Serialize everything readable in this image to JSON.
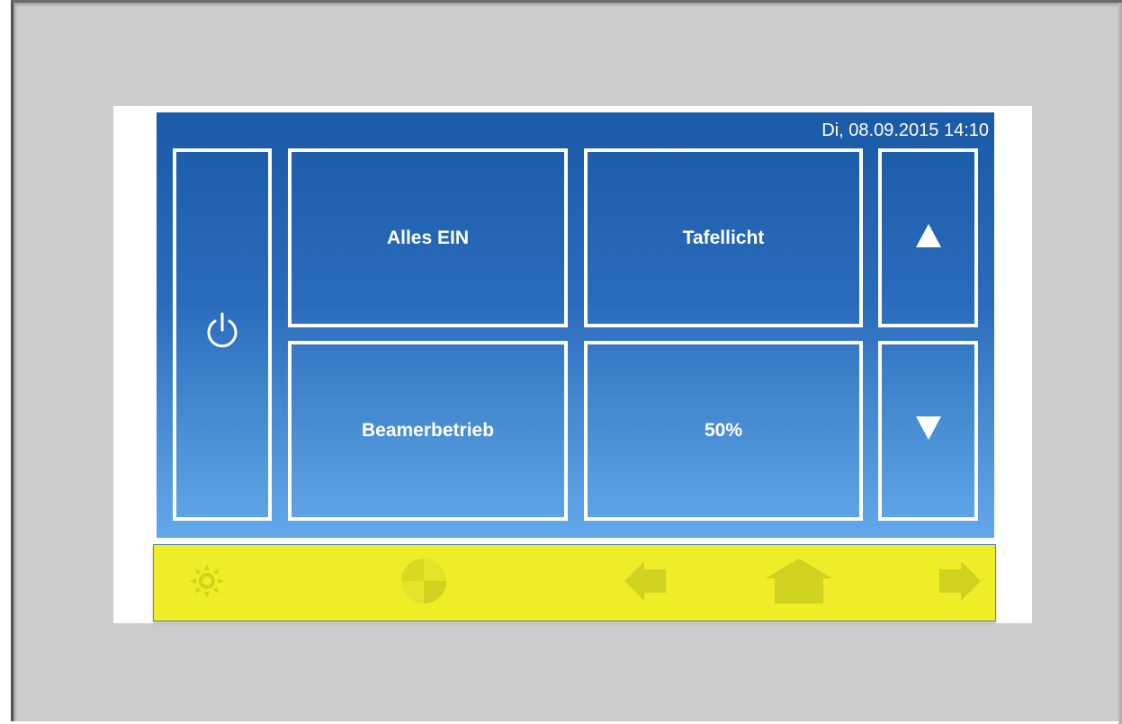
{
  "panel": {
    "datetime": "Di, 08.09.2015 14:10"
  },
  "tiles": {
    "power_icon": "power-icon",
    "alles_ein": "Alles EIN",
    "tafellicht": "Tafellicht",
    "beamerbetrieb": "Beamerbetrieb",
    "dim_level": "50%",
    "up_icon": "triangle-up-icon",
    "down_icon": "triangle-down-icon"
  },
  "nav": {
    "items": [
      "sun-icon",
      "pie-icon",
      "arrow-left-icon",
      "home-icon",
      "arrow-right-icon"
    ]
  },
  "colors": {
    "screen_top": "#1a5aa6",
    "screen_bottom": "#63a8ea",
    "tile_border": "#ffffff",
    "nav_bar": "#efec28",
    "nav_icon": "#cfd21f",
    "bezel": "#cccccc"
  }
}
